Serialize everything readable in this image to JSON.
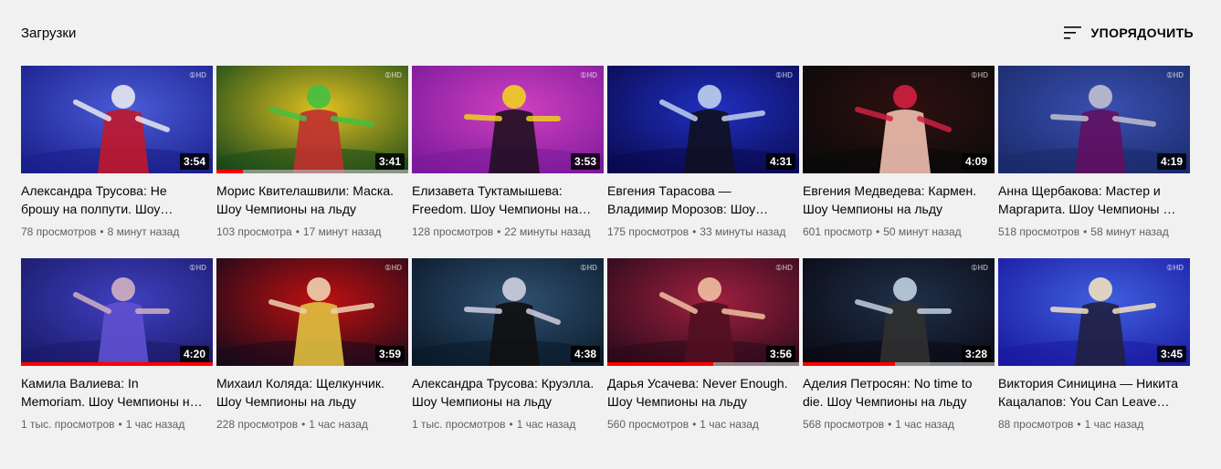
{
  "header": {
    "title": "Загрузки",
    "sort_label": "УПОРЯДОЧИТЬ"
  },
  "videos": [
    {
      "title": "Александра Трусова: Не брошу на полпути. Шоу Чемпионы на льду",
      "views": "78 просмотров",
      "time": "8 минут назад",
      "duration": "3:54",
      "progress": 0,
      "palette": [
        "#1a1f8a",
        "#4a5cd8",
        "#e8e8f0",
        "#c0182a"
      ]
    },
    {
      "title": "Морис Квителашвили: Маска. Шоу Чемпионы на льду",
      "views": "103 просмотра",
      "time": "17 минут назад",
      "duration": "3:41",
      "progress": 0.14,
      "palette": [
        "#1a4a1a",
        "#e0c020",
        "#44c040",
        "#c03030"
      ]
    },
    {
      "title": "Елизавета Туктамышева: Freedom. Шоу Чемпионы на льду",
      "views": "128 просмотров",
      "time": "22 минуты назад",
      "duration": "3:53",
      "progress": 0,
      "palette": [
        "#7a1a9a",
        "#d040c0",
        "#f0d020",
        "#201020"
      ]
    },
    {
      "title": "Евгения Тарасова — Владимир Морозов: Шоу Чемпионы на льду",
      "views": "175 просмотров",
      "time": "33 минуты назад",
      "duration": "4:31",
      "progress": 0,
      "palette": [
        "#0a0a50",
        "#2030c0",
        "#c0d0f0",
        "#101020"
      ]
    },
    {
      "title": "Евгения Медведева: Кармен. Шоу Чемпионы на льду",
      "views": "601 просмотр",
      "time": "50 минут назад",
      "duration": "4:09",
      "progress": 0,
      "palette": [
        "#0a0a0a",
        "#301010",
        "#d02040",
        "#f0c0b0"
      ]
    },
    {
      "title": "Анна Щербакова: Мастер и Маргарита. Шоу Чемпионы на льду",
      "views": "518 просмотров",
      "time": "58 минут назад",
      "duration": "4:19",
      "progress": 0,
      "palette": [
        "#1a2a6a",
        "#3a50b0",
        "#c0c0d0",
        "#601060"
      ]
    },
    {
      "title": "Камила Валиева: In Memoriam. Шоу Чемпионы на льду",
      "views": "1 тыс. просмотров",
      "time": "1 час назад",
      "duration": "4:20",
      "progress": 1,
      "palette": [
        "#1a1a6a",
        "#4040c0",
        "#d0b0c0",
        "#6050d0"
      ]
    },
    {
      "title": "Михаил Коляда: Щелкунчик. Шоу Чемпионы на льду",
      "views": "228 просмотров",
      "time": "1 час назад",
      "duration": "3:59",
      "progress": 0,
      "palette": [
        "#1a0a1a",
        "#c01010",
        "#f0d0b0",
        "#e0c040"
      ]
    },
    {
      "title": "Александра Трусова: Круэлла. Шоу Чемпионы на льду",
      "views": "1 тыс. просмотров",
      "time": "1 час назад",
      "duration": "4:38",
      "progress": 0,
      "palette": [
        "#0a1a2a",
        "#305070",
        "#d0d0e0",
        "#101010"
      ]
    },
    {
      "title": "Дарья Усачева: Never Enough. Шоу Чемпионы на льду",
      "views": "560 просмотров",
      "time": "1 час назад",
      "duration": "3:56",
      "progress": 0.55,
      "palette": [
        "#2a0a1a",
        "#a02040",
        "#f0c0a0",
        "#501020"
      ]
    },
    {
      "title": "Аделия Петросян: No time to die. Шоу Чемпионы на льду",
      "views": "568 просмотров",
      "time": "1 час назад",
      "duration": "3:28",
      "progress": 0.48,
      "palette": [
        "#0a0a14",
        "#20304a",
        "#c0d0e0",
        "#303030"
      ]
    },
    {
      "title": "Виктория Синицина — Никита Кацалапов: You Can Leave Your Hat On",
      "views": "88 просмотров",
      "time": "1 час назад",
      "duration": "3:45",
      "progress": 0,
      "palette": [
        "#1a1aa0",
        "#4060e0",
        "#f0e0c0",
        "#202040"
      ]
    }
  ]
}
